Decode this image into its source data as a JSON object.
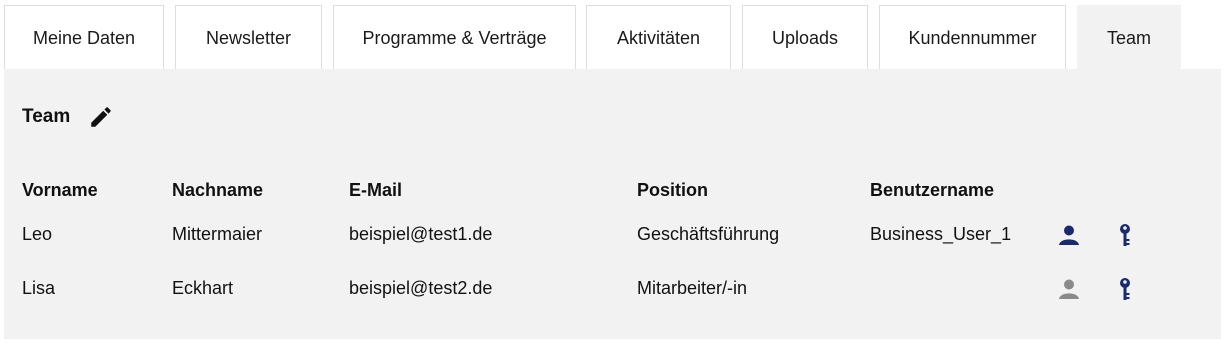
{
  "tabs": [
    {
      "label": "Meine Daten"
    },
    {
      "label": "Newsletter"
    },
    {
      "label": "Programme & Verträge"
    },
    {
      "label": "Aktivitäten"
    },
    {
      "label": "Uploads"
    },
    {
      "label": "Kundennummer"
    },
    {
      "label": "Team",
      "active": true
    }
  ],
  "section": {
    "title": "Team",
    "edit_icon": "pencil-icon"
  },
  "table": {
    "headers": [
      "Vorname",
      "Nachname",
      "E-Mail",
      "Position",
      "Benutzername"
    ],
    "rows": [
      {
        "cells": [
          "Leo",
          "Mittermaier",
          "beispiel@test1.de",
          "Geschäftsführung",
          "Business_User_1"
        ],
        "user_icon": "user-icon",
        "user_icon_color": "#1a2a6e",
        "key_icon": "key-icon"
      },
      {
        "cells": [
          "Lisa",
          "Eckhart",
          "beispiel@test2.de",
          "Mitarbeiter/-in",
          ""
        ],
        "user_icon": "user-icon",
        "user_icon_color": "#8a8a8a",
        "key_icon": "key-icon"
      }
    ]
  },
  "colors": {
    "panel_bg": "#f2f2f2",
    "accent_navy": "#1a2a6e",
    "inactive_gray": "#8a8a8a"
  }
}
